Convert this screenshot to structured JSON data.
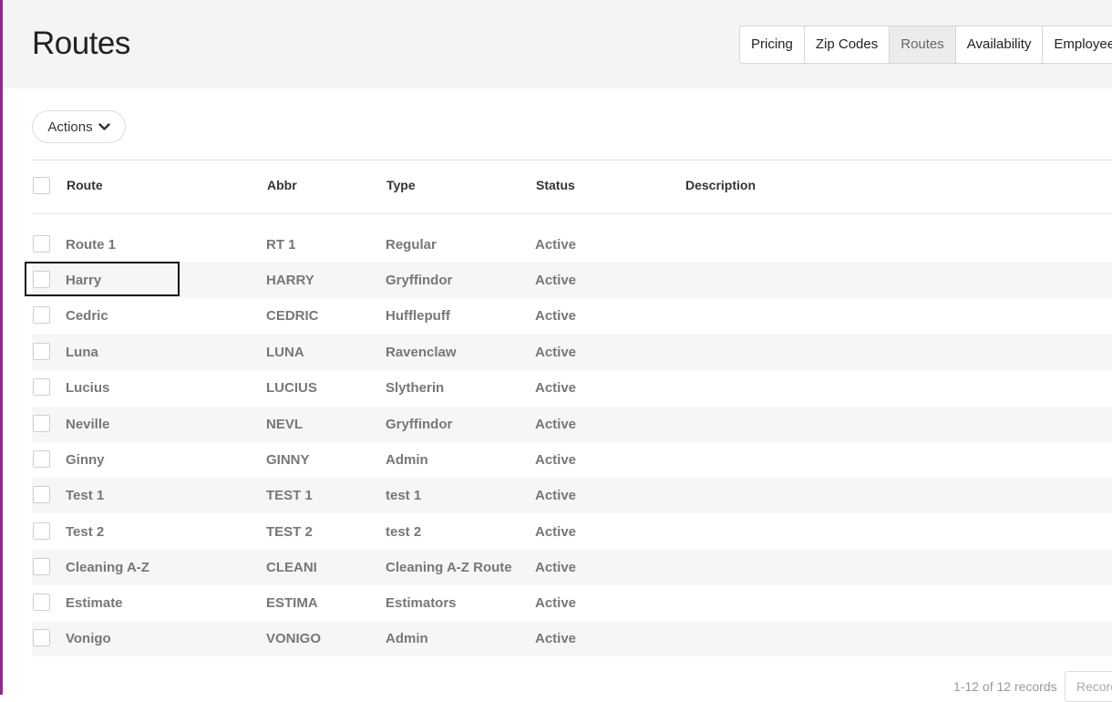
{
  "page": {
    "title": "Routes"
  },
  "tabs": [
    {
      "label": "Pricing"
    },
    {
      "label": "Zip Codes"
    },
    {
      "label": "Routes"
    },
    {
      "label": "Availability"
    },
    {
      "label": "Employees"
    }
  ],
  "toolbar": {
    "actions_label": "Actions"
  },
  "table": {
    "headers": {
      "route": "Route",
      "abbr": "Abbr",
      "type": "Type",
      "status": "Status",
      "description": "Description"
    },
    "rows": [
      {
        "route": "Route 1",
        "abbr": "RT 1",
        "type": "Regular",
        "status": "Active",
        "description": ""
      },
      {
        "route": "Harry",
        "abbr": "HARRY",
        "type": "Gryffindor",
        "status": "Active",
        "description": ""
      },
      {
        "route": "Cedric",
        "abbr": "CEDRIC",
        "type": "Hufflepuff",
        "status": "Active",
        "description": ""
      },
      {
        "route": "Luna",
        "abbr": "LUNA",
        "type": "Ravenclaw",
        "status": "Active",
        "description": ""
      },
      {
        "route": "Lucius",
        "abbr": "LUCIUS",
        "type": "Slytherin",
        "status": "Active",
        "description": ""
      },
      {
        "route": "Neville",
        "abbr": "NEVL",
        "type": "Gryffindor",
        "status": "Active",
        "description": ""
      },
      {
        "route": "Ginny",
        "abbr": "GINNY",
        "type": "Admin",
        "status": "Active",
        "description": ""
      },
      {
        "route": "Test 1",
        "abbr": "TEST 1",
        "type": "test 1",
        "status": "Active",
        "description": ""
      },
      {
        "route": "Test 2",
        "abbr": "TEST 2",
        "type": "test 2",
        "status": "Active",
        "description": ""
      },
      {
        "route": "Cleaning A-Z",
        "abbr": "CLEANI",
        "type": "Cleaning A-Z Route",
        "status": "Active",
        "description": ""
      },
      {
        "route": "Estimate",
        "abbr": "ESTIMA",
        "type": "Estimators",
        "status": "Active",
        "description": ""
      },
      {
        "route": "Vonigo",
        "abbr": "VONIGO",
        "type": "Admin",
        "status": "Active",
        "description": ""
      }
    ]
  },
  "footer": {
    "count_text": "1-12 of 12 records",
    "records_label": "Records"
  },
  "colors": {
    "accent": "#8e2a8e",
    "active_tab_bg": "#ececec"
  }
}
